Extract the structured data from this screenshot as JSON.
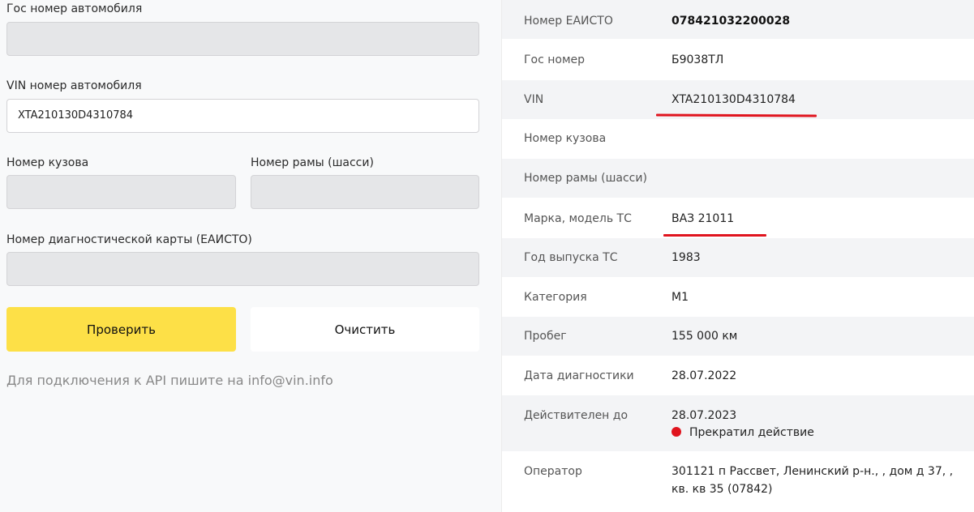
{
  "form": {
    "plate_label": "Гос номер автомобиля",
    "plate_value": "",
    "vin_label": "VIN номер автомобиля",
    "vin_value": "XTA210130D4310784",
    "body_label": "Номер кузова",
    "body_value": "",
    "frame_label": "Номер рамы (шасси)",
    "frame_value": "",
    "diag_label": "Номер диагностической карты (ЕАИСТО)",
    "diag_value": "",
    "check_button": "Проверить",
    "clear_button": "Очистить",
    "api_note": "Для подключения к API пишите на info@vin.info"
  },
  "result": {
    "rows": [
      {
        "key": "Номер ЕАИСТО",
        "value": "078421032200028"
      },
      {
        "key": "Гос номер",
        "value": "Б9038ТЛ"
      },
      {
        "key": "VIN",
        "value": "XTA210130D4310784"
      },
      {
        "key": "Номер кузова",
        "value": ""
      },
      {
        "key": "Номер рамы (шасси)",
        "value": ""
      },
      {
        "key": "Марка, модель ТС",
        "value": "ВАЗ 21011"
      },
      {
        "key": "Год выпуска ТС",
        "value": "1983"
      },
      {
        "key": "Категория",
        "value": "M1"
      },
      {
        "key": "Пробег",
        "value": "155 000 км"
      },
      {
        "key": "Дата диагностики",
        "value": "28.07.2022"
      },
      {
        "key": "Действителен до",
        "value": "28.07.2023",
        "status": "Прекратил действие"
      },
      {
        "key": "Оператор",
        "value": "301121 п Рассвет, Ленинский р-н., , дом д 37, ,",
        "value_line2": "кв. кв 35 (07842)"
      }
    ]
  },
  "colors": {
    "primary_button": "#fde047",
    "status_dot": "#e0141e",
    "annotation_underline": "#e0141e"
  }
}
